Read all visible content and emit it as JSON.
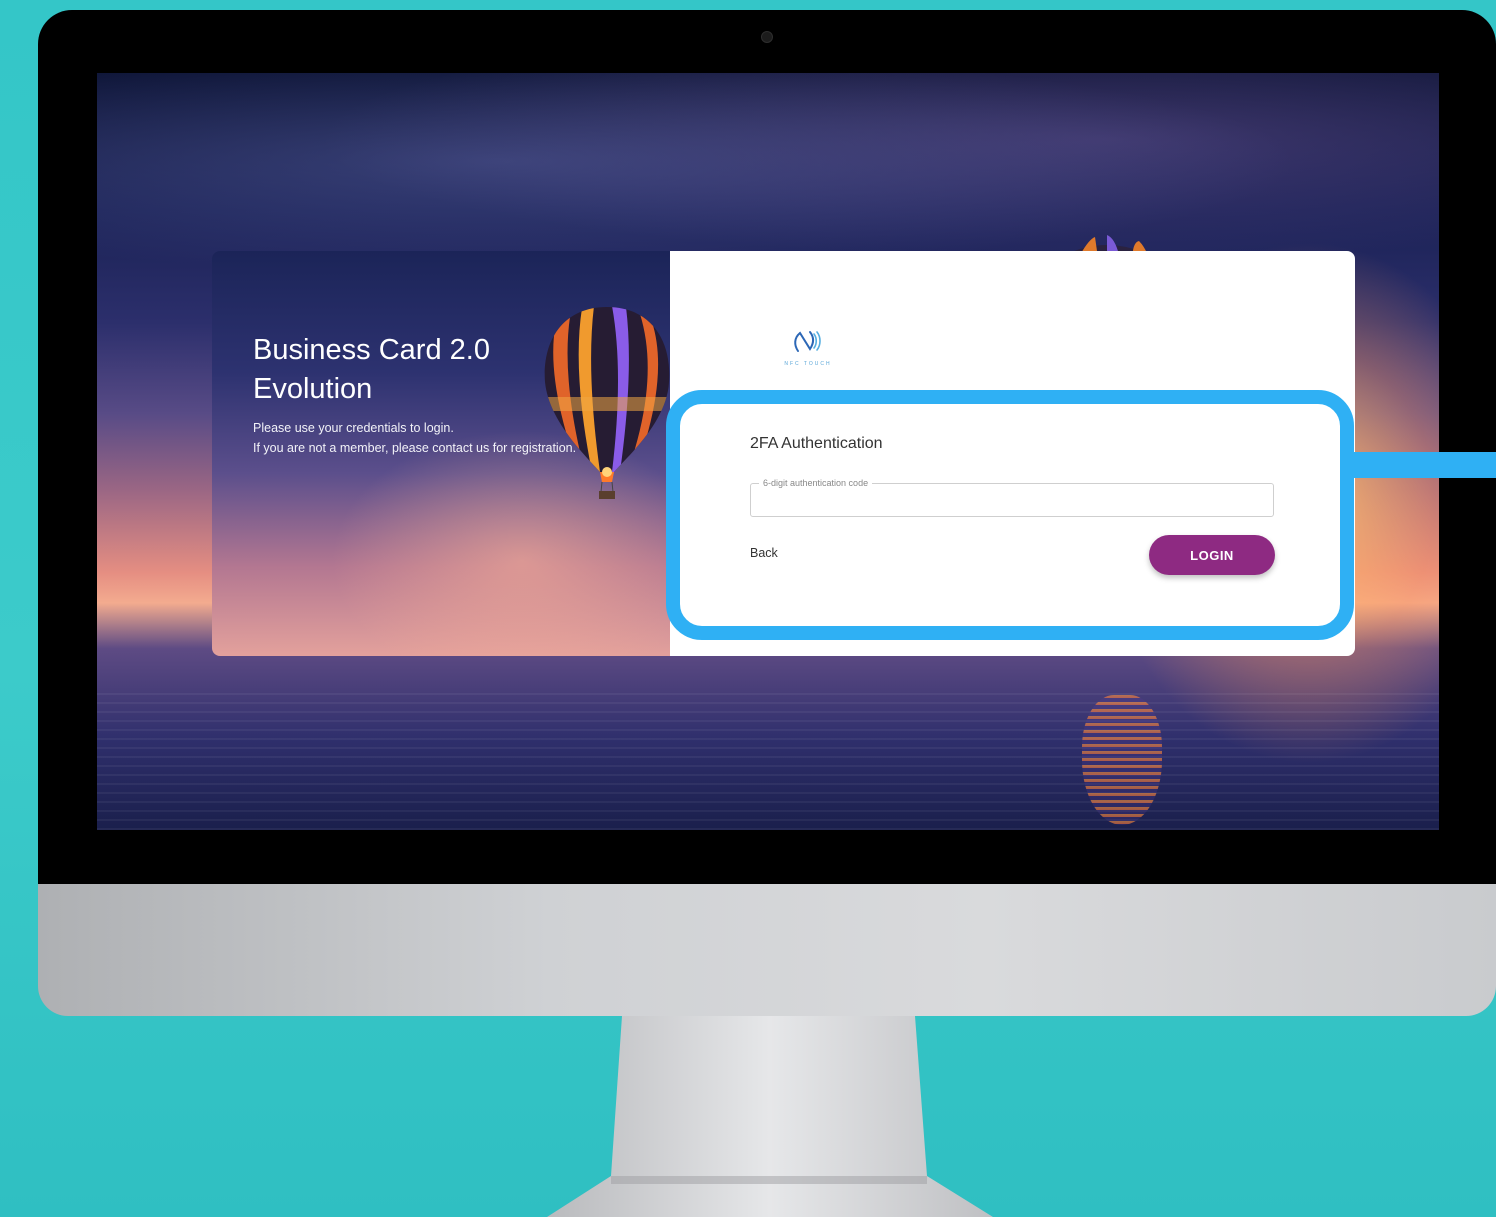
{
  "brand": {
    "title_line1": "Business Card 2.0",
    "title_line2": "Evolution",
    "subtitle_line1": "Please use your credentials to login.",
    "subtitle_line2": "If you are not a member, please contact us for registration."
  },
  "logo": {
    "text": "NFC TOUCH",
    "icon": "nfc-icon"
  },
  "form": {
    "title": "2FA Authentication",
    "code_label": "6-digit authentication code",
    "code_value": "",
    "back_label": "Back",
    "login_label": "LOGIN"
  },
  "colors": {
    "accent": "#8e2a82",
    "highlight": "#2fb0f4",
    "background": "#3ccbca"
  }
}
